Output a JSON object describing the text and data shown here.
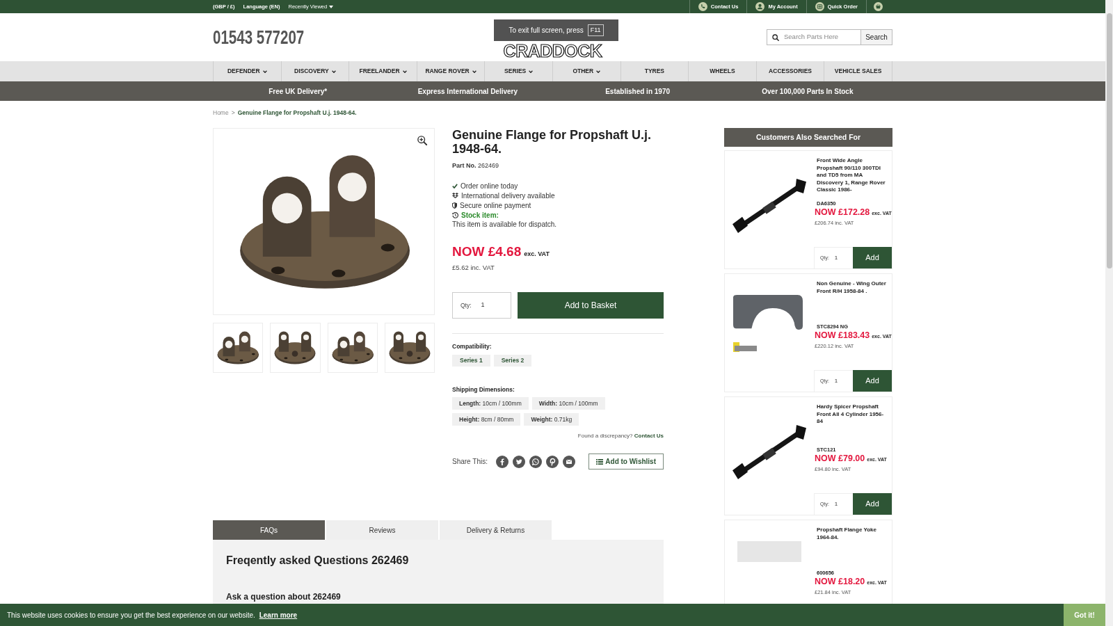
{
  "top_bar": {
    "left": [
      {
        "kind": "link",
        "label": "(GBP / £)"
      },
      {
        "kind": "link",
        "label": "Language (EN)"
      },
      {
        "kind": "dropdown",
        "label": "Recently Viewed"
      }
    ],
    "right": [
      {
        "kind": "contact",
        "label": "Contact Us"
      },
      {
        "kind": "account",
        "label": "My Account"
      },
      {
        "kind": "quick_order",
        "label": "Quick Order"
      }
    ]
  },
  "fullscreen_notice": {
    "text": "To exit full screen, press",
    "key": "F11"
  },
  "header": {
    "phone": "01543 577207",
    "logo": "CRADDOCK",
    "search": {
      "placeholder": "Search Parts Here",
      "button": "Search"
    }
  },
  "nav": [
    {
      "label": "DEFENDER",
      "dropdown": true
    },
    {
      "label": "DISCOVERY",
      "dropdown": true
    },
    {
      "label": "FREELANDER",
      "dropdown": true
    },
    {
      "label": "RANGE ROVER",
      "dropdown": true
    },
    {
      "label": "SERIES",
      "dropdown": true
    },
    {
      "label": "OTHER",
      "dropdown": true
    },
    {
      "label": "TYRES",
      "dropdown": false
    },
    {
      "label": "WHEELS",
      "dropdown": false
    },
    {
      "label": "ACCESSORIES",
      "dropdown": false
    },
    {
      "label": "VEHICLE SALES",
      "dropdown": false
    }
  ],
  "usp_bar": [
    "Free UK Delivery*",
    "Express International Delivery",
    "Established in 1970",
    "Over 100,000 Parts In Stock"
  ],
  "breadcrumb": {
    "separator": ">",
    "items": [
      {
        "label": "Home",
        "current": false
      },
      {
        "label": "Genuine Flange for Propshaft U.j. 1948-64.",
        "current": true
      }
    ]
  },
  "gallery": {
    "thumbnails": [
      {
        "kind": "angled"
      },
      {
        "kind": "front"
      },
      {
        "kind": "angled"
      },
      {
        "kind": "front"
      }
    ]
  },
  "product": {
    "title": "Genuine Flange for Propshaft U.j. 1948-64.",
    "part_no": "**Part No.** 262469",
    "features": [
      {
        "kind": "check",
        "text": "Order online today"
      },
      {
        "kind": "delivery",
        "text": "International delivery available"
      },
      {
        "kind": "secure",
        "text": "Secure online payment"
      },
      {
        "kind": "stock",
        "text": "Stock item:"
      }
    ],
    "stock_note": "This item is available for dispatch.",
    "price": {
      "now": "NOW £4.68",
      "tax": "exc. VAT",
      "inc": "£5.62 inc. VAT"
    },
    "quantity": {
      "label": "Qty:",
      "value": "1"
    },
    "add_button": "Add to Basket",
    "compatibility": {
      "label": "Compatibility:",
      "tags": [
        "Series 1",
        "Series 2"
      ]
    },
    "shipping": {
      "label": "Shipping Dimensions:",
      "items": [
        "**Length:** 10cm / 100mm",
        "**Width:** 10cm / 100mm",
        "**Height:** 8cm / 80mm",
        "**Weight:** 0.71kg"
      ]
    },
    "discrepancy": {
      "text": "Found a discrepancy?",
      "link": "Contact Us"
    },
    "share_label": "Share This:",
    "wishlist_button": "Add to Wishlist"
  },
  "tabs": [
    {
      "label": "FAQs",
      "selected": true
    },
    {
      "label": "Reviews",
      "selected": false
    },
    {
      "label": "Delivery & Returns",
      "selected": false
    }
  ],
  "faq": {
    "title": "Freqently asked Questions 262469",
    "ask": "Ask a question about 262469"
  },
  "sidebar": {
    "title": "Customers Also Searched For",
    "products": [
      {
        "kind": "propshaft",
        "title": "Front Wide Angle Propshaft 90/110 300TDI and TD5 from MA Discovery 1, Range Rover Classic 1986-",
        "code": "DA6350",
        "price": "NOW £172.28",
        "tax": "exc. VAT",
        "inc": "£206.74 inc. VAT",
        "quantity": {
          "label": "Qty:",
          "value": "1"
        },
        "button": "Add"
      },
      {
        "kind": "wing",
        "title": "Non Genuine - Wing Outer Front R/H 1958-84 .",
        "code": "STC8294 NG",
        "price": "NOW £183.43",
        "tax": "exc. VAT",
        "inc": "£220.12 inc. VAT",
        "quantity": {
          "label": "Qty:",
          "value": "1"
        },
        "button": "Add"
      },
      {
        "kind": "propshaft",
        "title": "Hardy Spicer Propshaft Front All 4 Cylinder 1956-84",
        "code": "STC121",
        "price": "NOW £79.00",
        "tax": "exc. VAT",
        "inc": "£94.80 inc. VAT",
        "quantity": {
          "label": "Qty:",
          "value": "1"
        },
        "button": "Add"
      },
      {
        "kind": "placeholder",
        "title": "Propshaft Flange Yoke 1964-84.",
        "code": "600656",
        "price": "NOW £18.20",
        "tax": "exc. VAT",
        "inc": "£21.84 inc. VAT"
      }
    ]
  },
  "cookie_bar": {
    "text": "This website uses cookies to ensure you get the best experience on our website.",
    "link": "Learn more",
    "button": "Got it!"
  }
}
